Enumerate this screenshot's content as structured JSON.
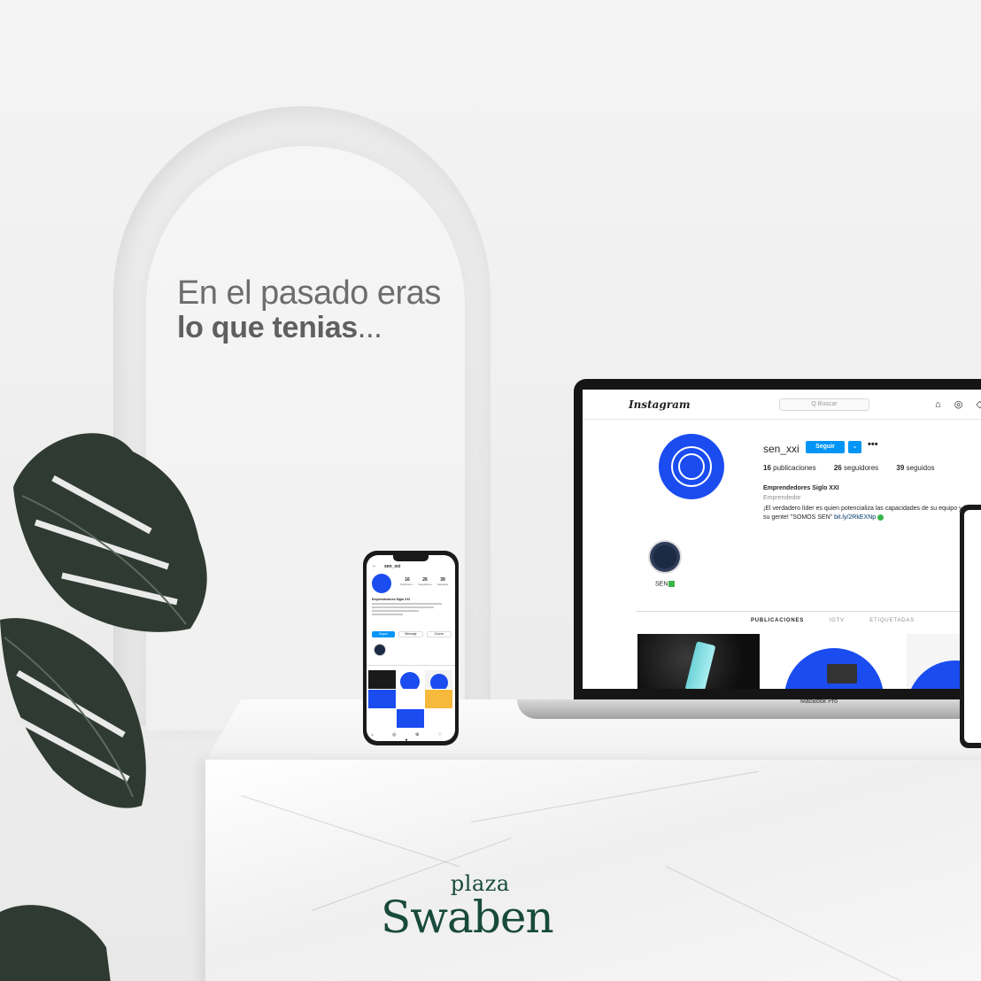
{
  "headline": {
    "line1": "En el pasado eras",
    "line2": "lo que tenias",
    "ellipsis": "..."
  },
  "laptop": {
    "instagram": {
      "logo": "Instagram",
      "search_placeholder": "Q Buscar",
      "nav_icons": "⌂ ◎ ◇",
      "username": "sen_xxi",
      "follow_label": "Seguir",
      "dropdown_label": "⌄",
      "more_label": "•••",
      "stats": {
        "posts": "16",
        "posts_label": "publicaciones",
        "followers": "26",
        "followers_label": "seguidores",
        "following": "39",
        "following_label": "seguidos"
      },
      "display_name": "Emprendedores Siglo XXI",
      "category": "Emprendedor",
      "bio_line1": "¡El verdadero líder es quien potencializa las capacidades de su equipo y ha",
      "bio_line2": "su gente! \"SOMOS SEN\"",
      "bio_link": "bit.ly/2RkEXNp",
      "highlight_label": "SEN",
      "tabs": [
        "PUBLICACIONES",
        "IGTV",
        "ETIQUETADAS"
      ]
    },
    "base_label": "MacBook Pro"
  },
  "phone": {
    "back": "←",
    "username": "sen_xxi",
    "stats": [
      {
        "value": "16",
        "label": "Publicacio..."
      },
      {
        "value": "26",
        "label": "Seguidores"
      },
      {
        "value": "39",
        "label": "Seguidos"
      }
    ],
    "display_name": "Emprendedores Siglo XXI",
    "buttons": [
      "Seguir",
      "Mensaje",
      "Correo"
    ],
    "nav": "⌂ ◎ ⊕ ♡ ●"
  },
  "brand": {
    "small": "plaza",
    "big": "Swaben"
  },
  "colors": {
    "instagram_blue": "#0095f6",
    "sen_blue": "#1a4cf0",
    "brand_green": "#184a3c"
  }
}
